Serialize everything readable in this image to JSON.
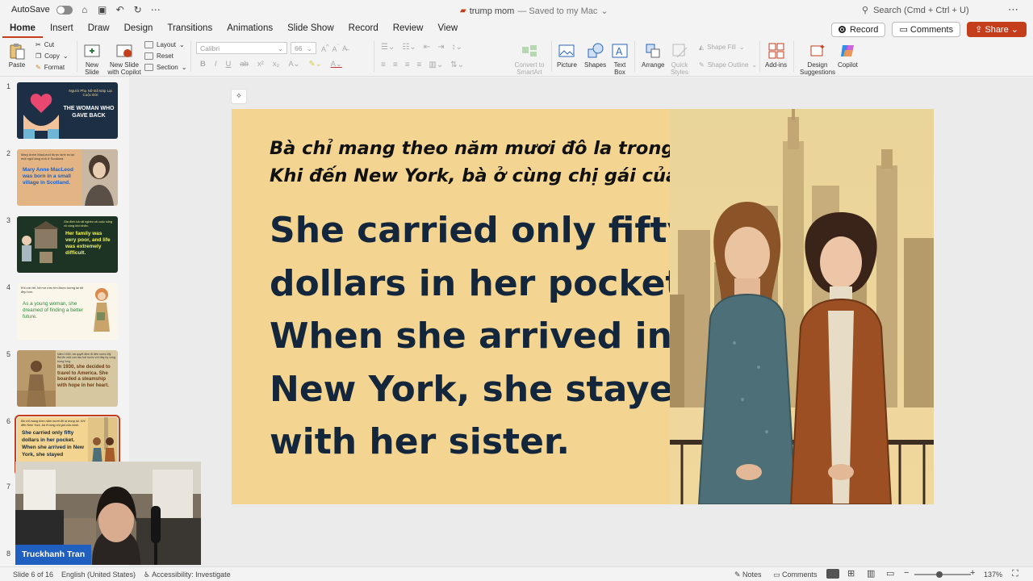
{
  "titlebar": {
    "autosave_label": "AutoSave",
    "file_name": "trump mom",
    "saved_status": "— Saved to my Mac",
    "search_placeholder": "Search (Cmd + Ctrl + U)"
  },
  "tabs": [
    "Home",
    "Insert",
    "Draw",
    "Design",
    "Transitions",
    "Animations",
    "Slide Show",
    "Record",
    "Review",
    "View"
  ],
  "actions": {
    "record": "Record",
    "comments": "Comments",
    "share": "Share"
  },
  "ribbon": {
    "paste": "Paste",
    "cut": "Cut",
    "copy": "Copy",
    "format": "Format",
    "new_slide": "New Slide",
    "new_slide_copilot": "New Slide with Copilot",
    "layout": "Layout",
    "reset": "Reset",
    "section": "Section",
    "font_name": "Calibri",
    "font_size": "66",
    "convert_smartart": "Convert to SmartArt",
    "picture": "Picture",
    "shapes": "Shapes",
    "text_box": "Text Box",
    "arrange": "Arrange",
    "quick_styles": "Quick Styles",
    "shape_fill": "Shape Fill",
    "shape_outline": "Shape Outline",
    "add_ins": "Add-ins",
    "design_suggestions": "Design Suggestions",
    "copilot": "Copilot"
  },
  "thumbnails": [
    {
      "num": "1",
      "small": "Người Phụ Nữ Đã Đáp Lại Cuộc Đời",
      "big": "THE WOMAN WHO GAVE BACK"
    },
    {
      "num": "2",
      "small": "Mary Anne MacLeod được sinh ra tại một ngôi làng nhỏ ở Scotland.",
      "big": "Mary Anne MacLeod was born in a small village in Scotland."
    },
    {
      "num": "3",
      "small": "Gia đình bà rất nghèo và cuộc sống vô cùng khó khăn.",
      "big": "Her family was very poor, and life was extremely difficult."
    },
    {
      "num": "4",
      "small": "Khi còn trẻ, bà mơ ước tìm được tương lai tốt đẹp hơn.",
      "big": "As a young woman, she dreamed of finding a better future."
    },
    {
      "num": "5",
      "small": "Năm 1930, bà quyết định đi đến nước Mỹ. Bà lên một con tàu hơi nước với đầy hy vọng trong lòng.",
      "big": "In 1930, she decided to travel to America. She boarded a steamship with hope in her heart."
    },
    {
      "num": "6",
      "small": "Bà chỉ mang theo năm mươi đô la trong túi. Khi đến New York, bà ở cùng chị gái của mình.",
      "big": "She carried only fifty dollars in her pocket. When she arrived in New York, she stayed"
    },
    {
      "num": "7"
    },
    {
      "num": "8"
    }
  ],
  "slide": {
    "vi_line1": "Bà chỉ mang theo năm mươi đô la trong túi.",
    "vi_line2": "Khi đến New York, bà ở cùng chị gái của mình.",
    "en_line1": "She carried only fifty",
    "en_line2": "dollars in her pocket.",
    "en_line3": "When she arrived in",
    "en_line4": "New York, she stayed",
    "en_line5": "with her sister."
  },
  "webcam": {
    "name": "Truckhanh Tran"
  },
  "statusbar": {
    "slide_count": "Slide 6 of 16",
    "language": "English (United States)",
    "accessibility": "Accessibility: Investigate",
    "notes": "Notes",
    "comments": "Comments",
    "zoom": "137%"
  },
  "colors": {
    "accent": "#c43e1c",
    "slide_bg": "#f3d591",
    "slide_text": "#13263b"
  }
}
